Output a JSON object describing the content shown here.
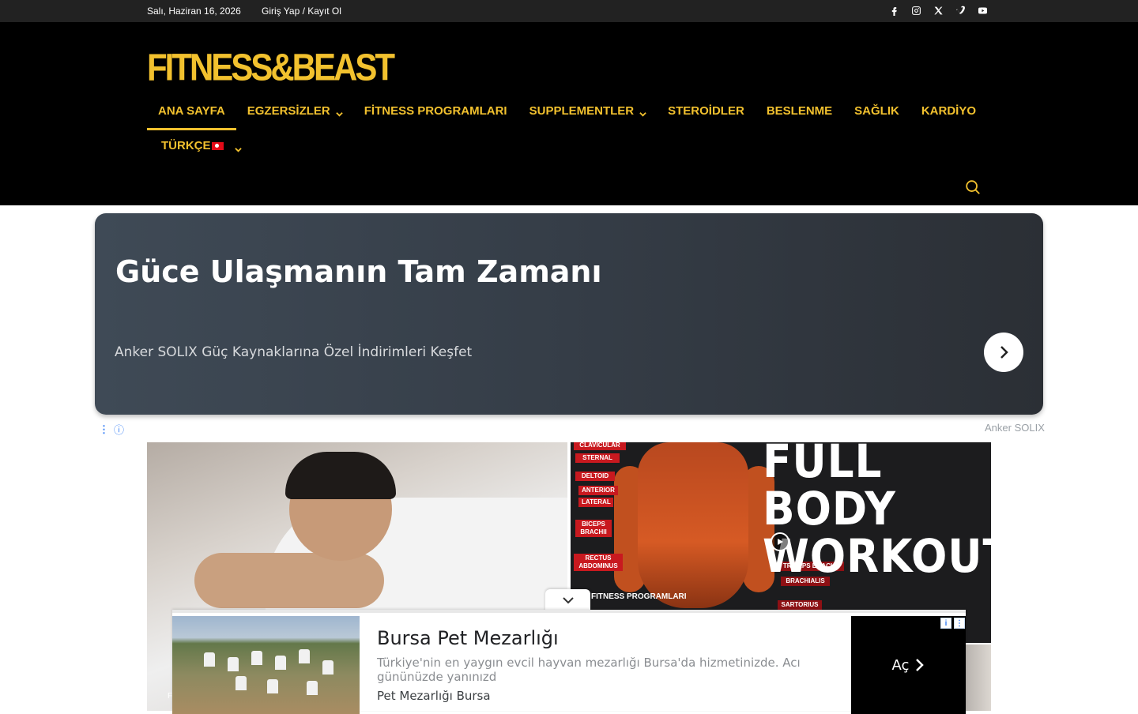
{
  "topbar": {
    "date": "Salı, Haziran 16, 2026",
    "login": "Giriş Yap / Kayıt Ol",
    "socials": [
      "facebook-icon",
      "instagram-icon",
      "x-icon",
      "vimeo-icon",
      "youtube-icon"
    ]
  },
  "header": {
    "logo": "FITNESS&BEAST",
    "nav": [
      {
        "label": "ANA SAYFA",
        "active": true,
        "dropdown": false
      },
      {
        "label": "EGZERSİZLER",
        "active": false,
        "dropdown": true
      },
      {
        "label": "FİTNESS PROGRAMLARI",
        "active": false,
        "dropdown": false
      },
      {
        "label": "SUPPLEMENTLER",
        "active": false,
        "dropdown": true
      },
      {
        "label": "STEROİDLER",
        "active": false,
        "dropdown": false
      },
      {
        "label": "BESLENME",
        "active": false,
        "dropdown": false
      },
      {
        "label": "SAĞLIK",
        "active": false,
        "dropdown": false
      },
      {
        "label": "KARDİYO",
        "active": false,
        "dropdown": false
      }
    ],
    "language": "TÜRKÇE",
    "accent_color": "#f2c12e"
  },
  "ad_banner": {
    "title": "Güce Ulaşmanın Tam Zamanı",
    "subtitle": "Anker SOLIX Güç Kaynaklarına Özel İndirimleri Keşfet",
    "sponsor": "Anker SOLIX"
  },
  "featured": {
    "right_title_line1": "FULL BODY",
    "right_title_line2": "WORKOUT",
    "right_category": "FITNESS PROGRAMLARI",
    "left_category_fragment": "F",
    "muscle_labels_left": [
      "CLAVICULAR",
      "STERNAL",
      "DELTOID",
      "ANTERIOR",
      "LATERAL",
      "BICEPS BRACHII",
      "RECTUS ABDOMINUS"
    ],
    "muscle_labels_right": [
      "TRICEPS BRACHII",
      "BRACHIALIS",
      "SARTORIUS"
    ]
  },
  "anchor_ad": {
    "title": "Bursa Pet Mezarlığı",
    "description": "Türkiye'nin en yaygın evcil hayvan mezarlığı Bursa'da hizmetinizde. Acı gününüzde yanınızd",
    "brand": "Pet Mezarlığı Bursa",
    "cta": "Aç"
  }
}
